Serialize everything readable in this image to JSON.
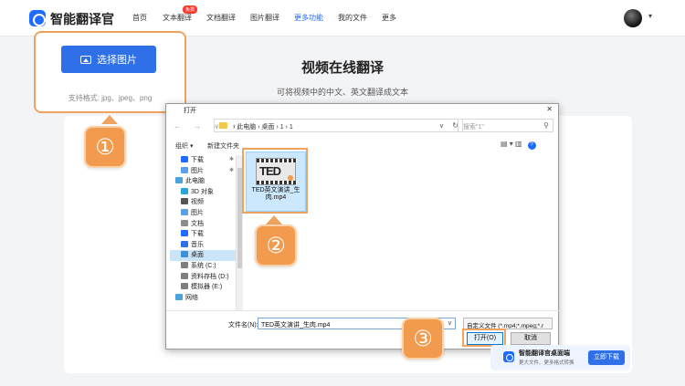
{
  "brand": "智能翻译官",
  "nav": {
    "items": [
      "首页",
      "文本翻译",
      "文档翻译",
      "图片翻译",
      "更多功能",
      "我的文件",
      "更多"
    ],
    "badge": "免费"
  },
  "page": {
    "title": "视频在线翻译",
    "subtitle": "可将视频中的中文、英文翻译成文本"
  },
  "upload": {
    "button_label": "选择图片",
    "formats": "支持格式: jpg、jpeg、png"
  },
  "markers": [
    "①",
    "②",
    "③"
  ],
  "dialog": {
    "title": "打开",
    "nav_arrows": "← → ∨ ↑",
    "breadcrumb": "›  此电脑  ›  桌面  ›  1  ›  1",
    "search_placeholder": "搜索\"1\"",
    "toolbar": {
      "organize": "组织 ▾",
      "new_folder": "新建文件夹",
      "view_icons": "▤ ▾  ▥"
    },
    "tree": [
      {
        "label": "下载",
        "icon": "download-icon",
        "color": "#1e6bff",
        "pinned": true
      },
      {
        "label": "图片",
        "icon": "picture-icon",
        "color": "#5aa0e6",
        "pinned": true
      },
      {
        "label": "此电脑",
        "icon": "computer-icon",
        "color": "#4aa3df",
        "top": true
      },
      {
        "label": "3D 对象",
        "icon": "cube-icon",
        "color": "#2aa6d6"
      },
      {
        "label": "视频",
        "icon": "video-icon",
        "color": "#555555"
      },
      {
        "label": "图片",
        "icon": "picture-icon",
        "color": "#5aa0e6"
      },
      {
        "label": "文档",
        "icon": "document-icon",
        "color": "#8c8c8c"
      },
      {
        "label": "下载",
        "icon": "download-icon",
        "color": "#1e6bff"
      },
      {
        "label": "音乐",
        "icon": "music-icon",
        "color": "#2f6fe8"
      },
      {
        "label": "桌面",
        "icon": "desktop-icon",
        "color": "#3d8fd9",
        "selected": true
      },
      {
        "label": "系统 (C:)",
        "icon": "drive-icon",
        "color": "#7f7f7f"
      },
      {
        "label": "资料存档 (D:)",
        "icon": "drive-icon",
        "color": "#7f7f7f"
      },
      {
        "label": "模拟器 (E:)",
        "icon": "drive-icon",
        "color": "#7f7f7f"
      },
      {
        "label": "网络",
        "icon": "network-icon",
        "color": "#4aa3df",
        "top": true
      }
    ],
    "file": {
      "thumb_text": "TED",
      "name": "TED英文演讲_生肉.mp4"
    },
    "filename_label": "文件名(N):",
    "filename_value": "TED英文演讲_生肉.mp4",
    "filetype": "自定义文件 (*.mp4;*.mpeg;*.r",
    "open_label": "打开(O)",
    "cancel_label": "取消"
  },
  "desktop_app": {
    "title": "智能翻译官桌面端",
    "subtitle": "更大文件、更多格式转换",
    "download_label": "立即下载"
  }
}
